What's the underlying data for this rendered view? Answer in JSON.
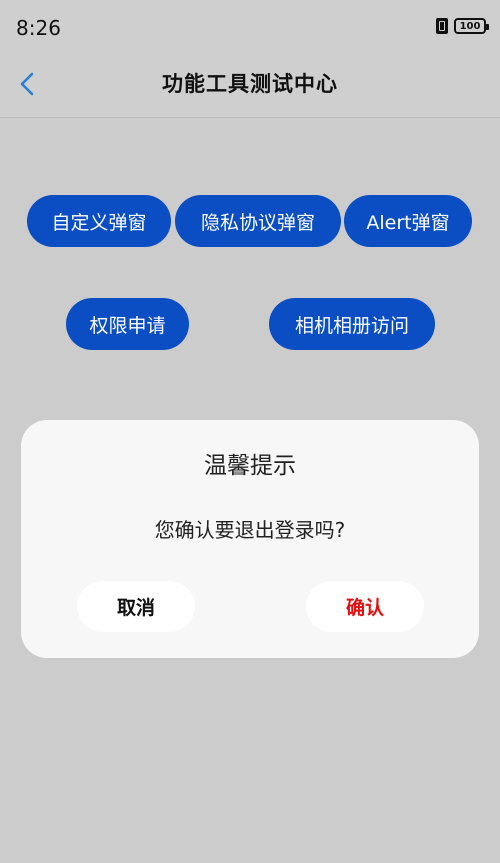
{
  "status_bar": {
    "time": "8:26",
    "battery": "100"
  },
  "nav": {
    "title": "功能工具测试中心"
  },
  "buttons": {
    "custom_dialog": "自定义弹窗",
    "privacy_dialog": "隐私协议弹窗",
    "alert_dialog": "Alert弹窗",
    "permission": "权限申请",
    "camera_album": "相机相册访问"
  },
  "dialog": {
    "title": "温馨提示",
    "message": "您确认要退出登录吗?",
    "cancel": "取消",
    "confirm": "确认"
  },
  "colors": {
    "primary_button": "#0b4ec4",
    "confirm_text": "#e01010",
    "back_icon": "#2a7fd8",
    "overlay_background": "#cccccc"
  }
}
